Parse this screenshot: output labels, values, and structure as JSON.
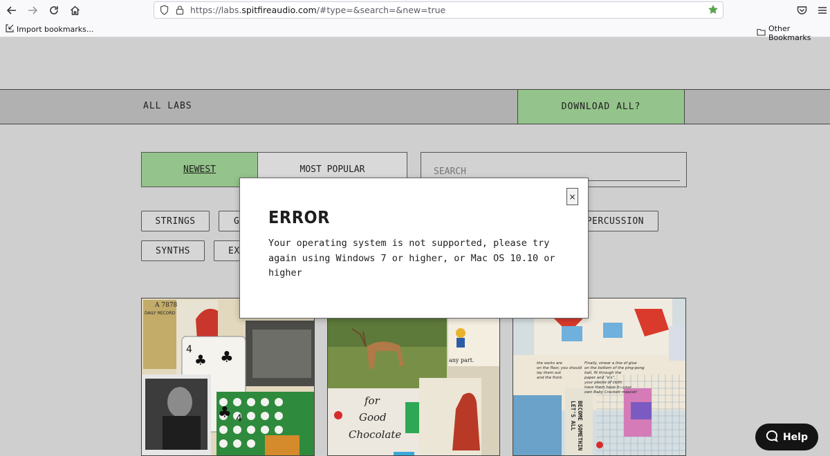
{
  "browser": {
    "url_prefix": "https://labs.",
    "url_domain": "spitfireaudio.com",
    "url_suffix": "/#type=&search=&new=true",
    "bookmarks": {
      "import": "Import bookmarks...",
      "other": "Other Bookmarks"
    }
  },
  "site": {
    "nav": {
      "all_labs": "ALL LABS",
      "download_all": "DOWNLOAD ALL?"
    },
    "tabs": {
      "newest": "NEWEST",
      "most_popular": "MOST POPULAR"
    },
    "search": {
      "placeholder": "SEARCH"
    },
    "categories": [
      "STRINGS",
      "G",
      "PERCUSSION",
      "SYNTHS",
      "EX"
    ],
    "cards": [
      {
        "texts": [
          "A 7878",
          "DAILY RECORD",
          "4",
          "4"
        ]
      },
      {
        "texts": [
          "for",
          "Good",
          "Chocolate",
          "any part."
        ]
      },
      {
        "texts": [
          "the socks are",
          "on the floor, you should",
          "lay them out",
          "and the front.",
          "Finally, smear a line of glue",
          "on the bottom of the ping-pong",
          "ball, fit through the",
          "paper and “e's”,",
          "your pieces of cloth",
          "have them have it—your",
          "own Baby Crockett mascot!",
          "LET'S ALL",
          "BECOME SOMETHIN"
        ]
      }
    ]
  },
  "modal": {
    "title": "ERROR",
    "message": "Your operating system is not supported, please try again using Windows 7 or higher, or Mac OS 10.10 or higher",
    "close_label": "×"
  },
  "help": {
    "label": "Help"
  },
  "colors": {
    "accent_green": "#94c38b",
    "background": "#cfcfcf",
    "help_bg": "#141414"
  }
}
